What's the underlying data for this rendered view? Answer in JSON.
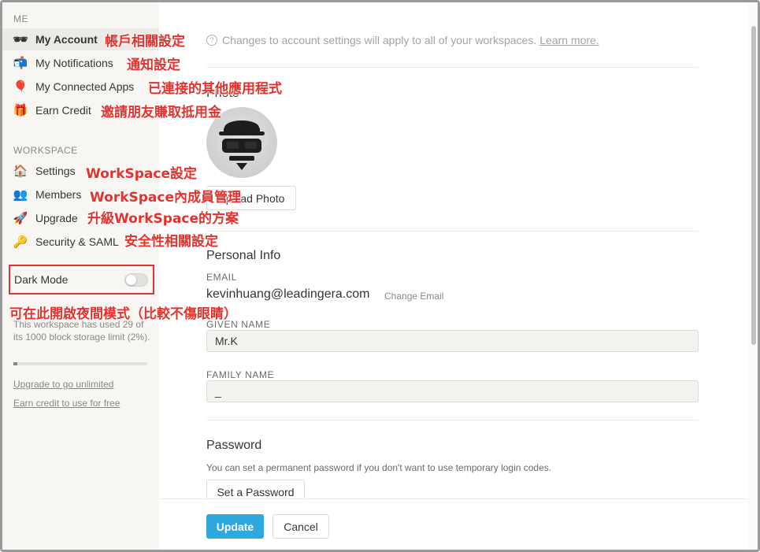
{
  "sidebar": {
    "me_label": "ME",
    "me_items": [
      {
        "label": "My Account",
        "icon": "glasses-face-icon",
        "glyph": "🕶"
      },
      {
        "label": "My Notifications",
        "icon": "mailbox-icon",
        "glyph": "📬"
      },
      {
        "label": "My Connected Apps",
        "icon": "balloon-icon",
        "glyph": "🎈"
      },
      {
        "label": "Earn Credit",
        "icon": "gift-icon",
        "glyph": "🎁"
      }
    ],
    "workspace_label": "WORKSPACE",
    "workspace_items": [
      {
        "label": "Settings",
        "icon": "house-icon",
        "glyph": "🏠"
      },
      {
        "label": "Members",
        "icon": "members-icon",
        "glyph": "👥"
      },
      {
        "label": "Upgrade",
        "icon": "rocket-icon",
        "glyph": "🚀"
      },
      {
        "label": "Security & SAML",
        "icon": "key-icon",
        "glyph": "🔑"
      }
    ],
    "dark_mode_label": "Dark Mode",
    "dark_mode_on": false,
    "storage_text": "This workspace has used 29 of its 1000 block storage limit (2%).",
    "storage_fraction": 0.029,
    "upgrade_link": "Upgrade to go unlimited",
    "earn_link": "Earn credit to use for free"
  },
  "main": {
    "notice_icon": "?",
    "notice_text": "Changes to account settings will apply to all of your workspaces.",
    "notice_link": "Learn more.",
    "photo_title": "Photo",
    "upload_button": "Upload Photo",
    "personal_info_title": "Personal Info",
    "email_label": "EMAIL",
    "email_value": "kevinhuang@leadingera.com",
    "change_email": "Change Email",
    "given_name_label": "GIVEN NAME",
    "given_name_value": "Mr.K",
    "family_name_label": "FAMILY NAME",
    "family_name_value": "_",
    "password_title": "Password",
    "password_desc": "You can set a permanent password if you don't want to use temporary login codes.",
    "set_password_button": "Set a Password"
  },
  "footer": {
    "update_button": "Update",
    "cancel_button": "Cancel"
  },
  "annotations": {
    "my_account": "帳戶相關設定",
    "notifications": "通知設定",
    "connected_apps": "已連接的其他應用程式",
    "earn_credit": "邀請朋友賺取抵用金",
    "settings": "WorkSpace設定",
    "members": "WorkSpace內成員管理",
    "upgrade": "升級WorkSpace的方案",
    "security": "安全性相關設定",
    "dark_mode": "可在此開啟夜間模式（比較不傷眼睛）"
  },
  "colors": {
    "accent_blue": "#2ea9e0",
    "annotation_red": "#e5322d",
    "sidebar_bg": "#f7f6f3"
  }
}
